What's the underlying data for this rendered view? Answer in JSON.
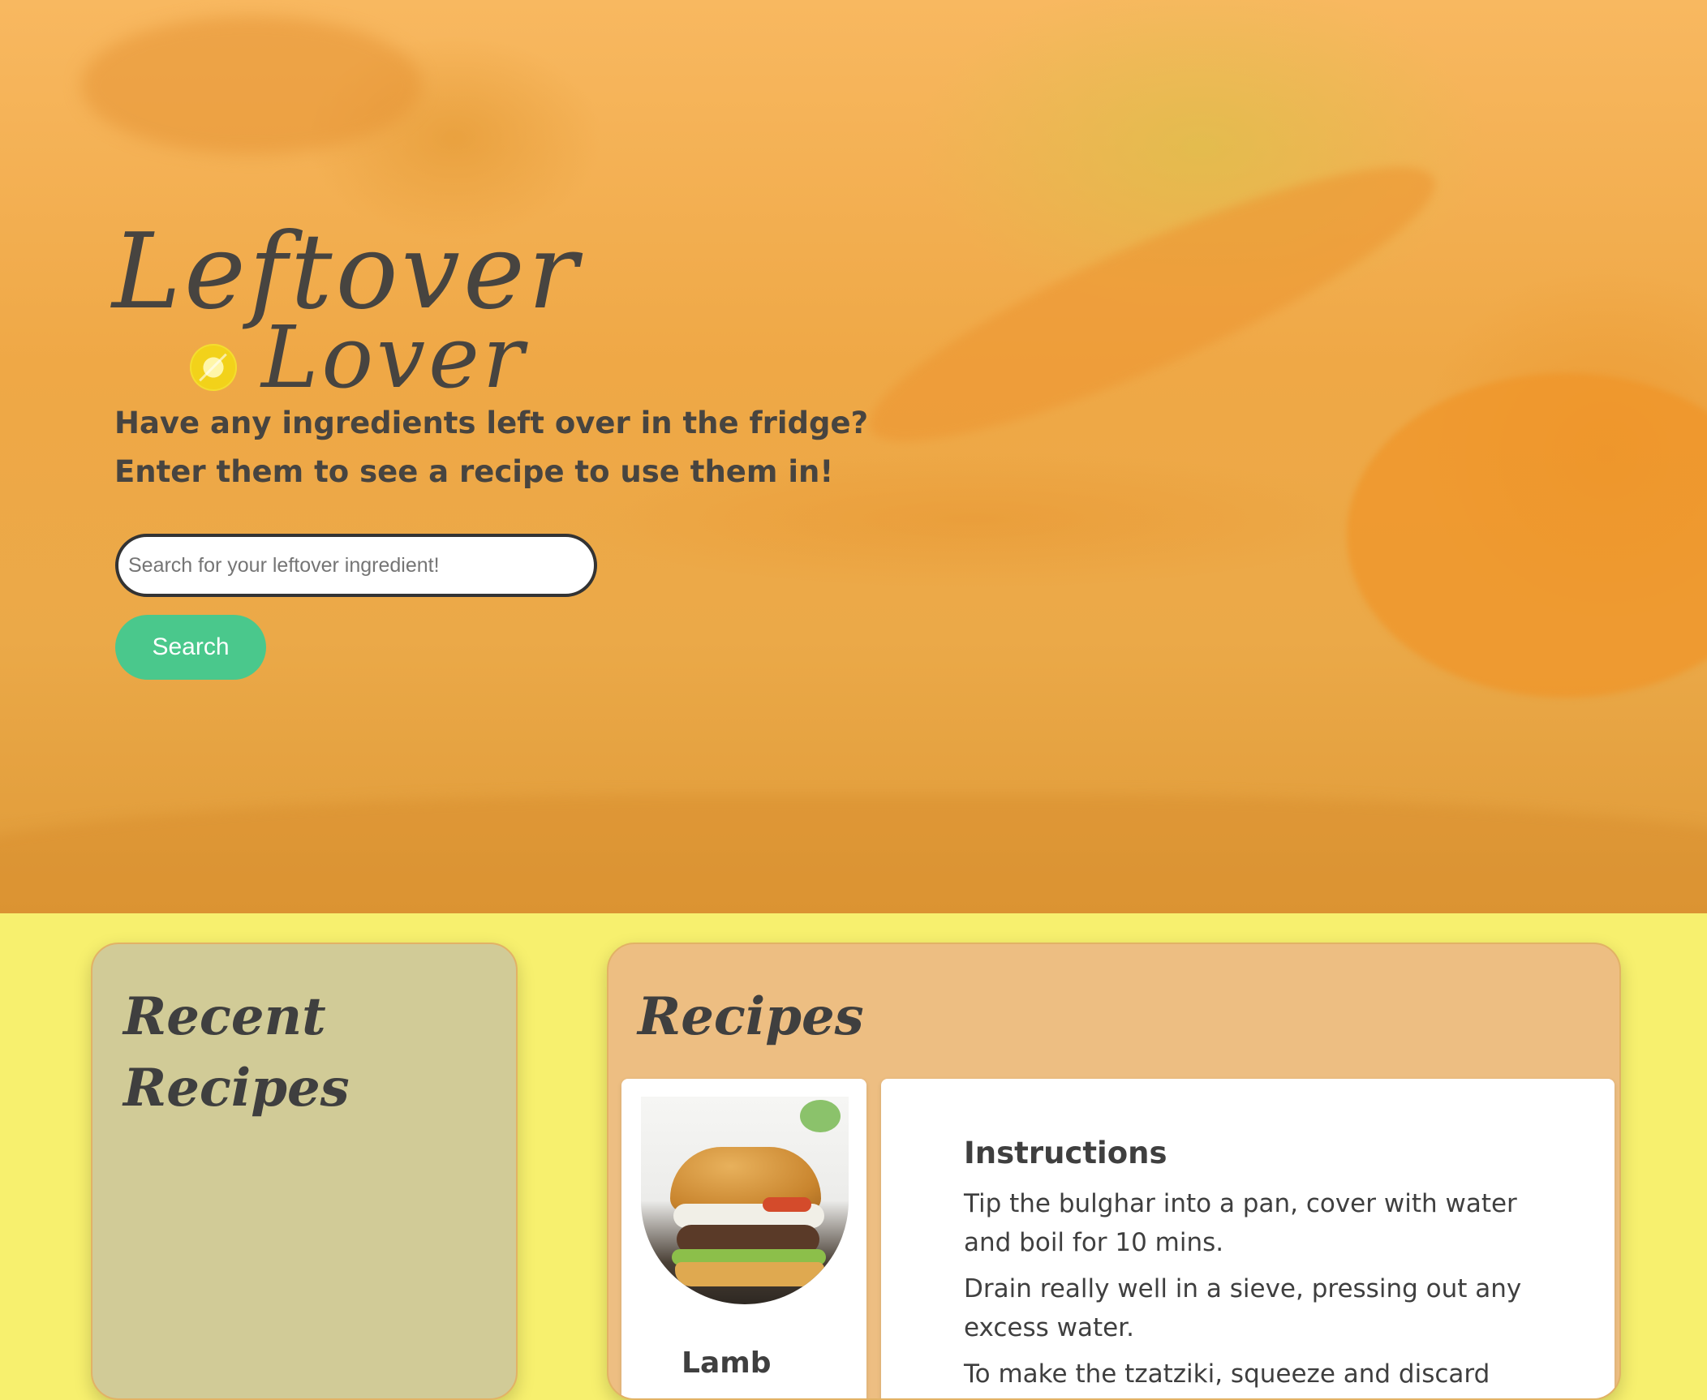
{
  "hero": {
    "logo_line1": "Leftover",
    "logo_line2": "Lover",
    "tagline_1": "Have any ingredients left over in the fridge?",
    "tagline_2": "Enter them to see a recipe to use them in!",
    "search_placeholder": "Search for your leftover ingredient!",
    "search_value": "",
    "search_button_label": "Search"
  },
  "recent": {
    "title": "Recent Recipes"
  },
  "recipes": {
    "title": "Recipes",
    "card": {
      "image_subject": "burger-image",
      "name": "Lamb",
      "instructions_heading": "Instructions",
      "steps": [
        "Tip the bulghar into a pan, cover with water and boil for 10 mins.",
        "Drain really well in a sieve, pressing out any excess water.",
        "To make the tzatziki, squeeze and discard"
      ]
    }
  },
  "colors": {
    "hero_overlay": "#f0a843",
    "page_background": "#f7f06e",
    "recent_card": "#d1cb97",
    "recipes_card": "#edbe82",
    "search_button": "#4ac88c",
    "text": "#3f3f3f"
  }
}
